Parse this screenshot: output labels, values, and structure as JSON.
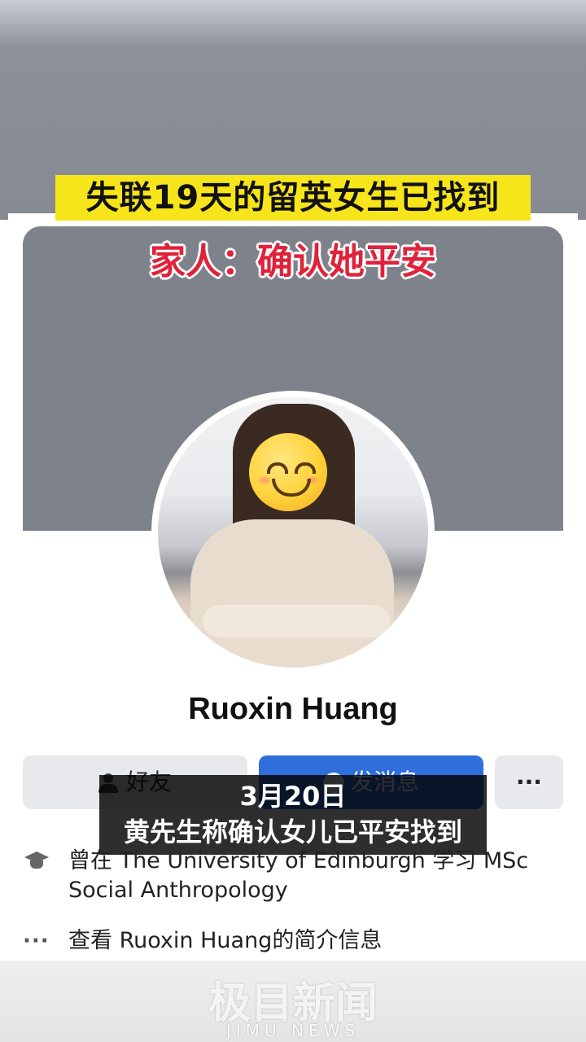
{
  "overlay": {
    "headline": "失联19天的留英女生已找到",
    "subheadline": "家人：确认她平安",
    "caption_line1": "3月20日",
    "caption_line2": "黄先生称确认女儿已平安找到"
  },
  "profile": {
    "name": "Ruoxin Huang",
    "avatar_overlay_icon": "smiling-face-emoji",
    "buttons": {
      "friends_label": "好友",
      "message_label": "发消息",
      "more_label": "···"
    },
    "education_text": "曾在 The University of Edinburgh 学习 MSc Social Anthropology",
    "about_link_text": "查看 Ruoxin Huang的简介信息"
  },
  "watermark": {
    "main": "极目新闻",
    "sub": "JIMU NEWS"
  },
  "colors": {
    "headline_bg": "#f6e51a",
    "subheadline_text": "#e0223a",
    "message_button": "#2f6fdc",
    "cover": "#7e828b"
  }
}
